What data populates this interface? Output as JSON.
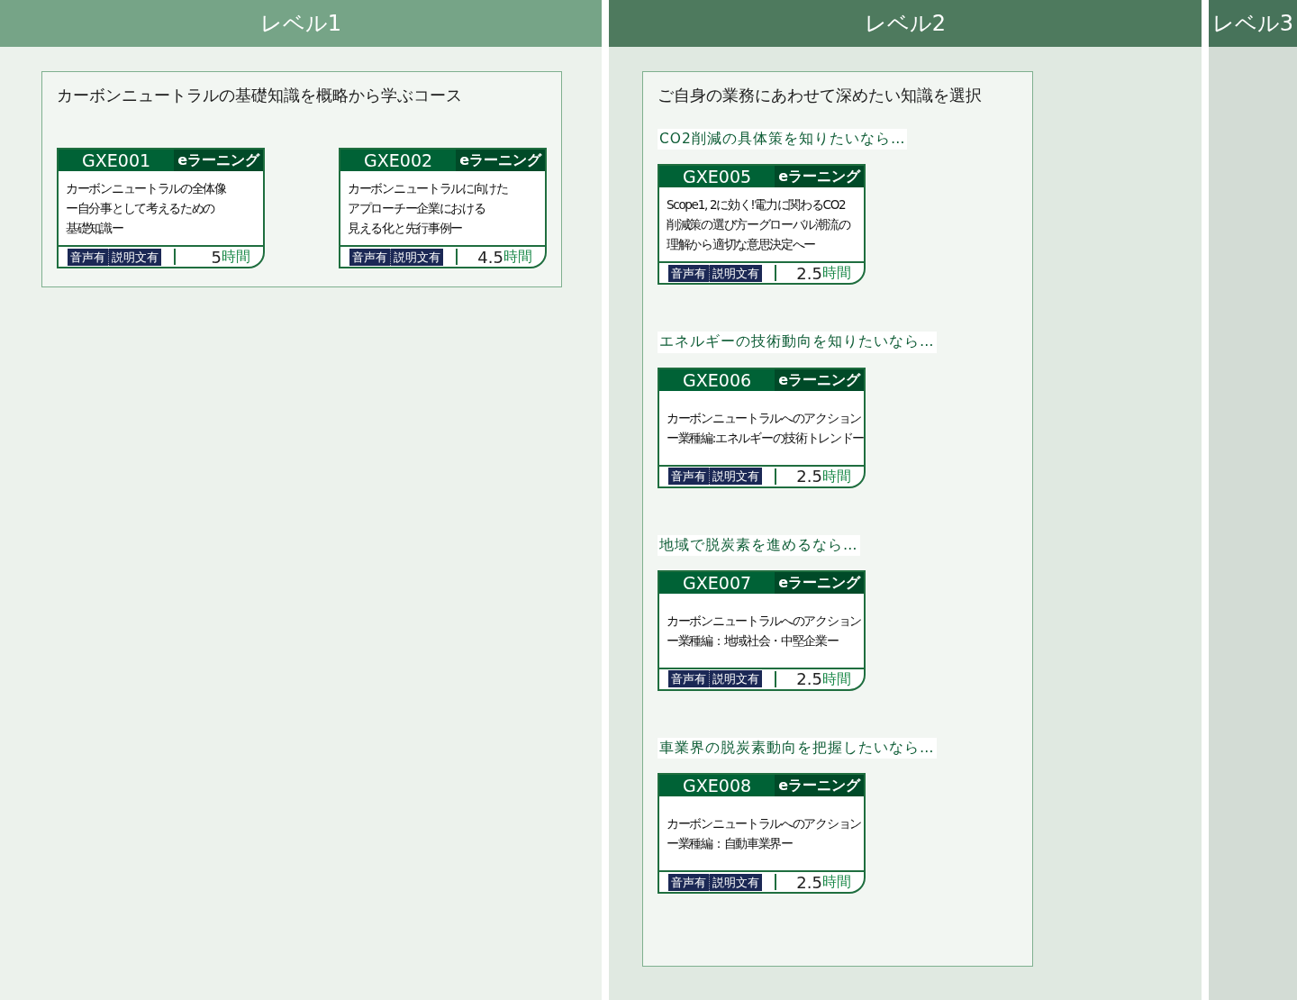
{
  "levels": [
    {
      "label": "レベル1",
      "groups": [
        {
          "title": "カーボンニュートラルの基礎知識を概略から学ぶコース",
          "courses": [
            {
              "code": "GXE001",
              "type": "eラーニング",
              "title_lines": [
                "カーボンニュートラルの全体像",
                "ー自分事として考えるための",
                "基礎知識ー"
              ],
              "tags": [
                "音声有",
                "説明文有"
              ],
              "hours": "5",
              "unit": "時間"
            },
            {
              "code": "GXE002",
              "type": "eラーニング",
              "title_lines": [
                "カーボンニュートラルに向けた",
                "アプローチー企業における",
                "見える化と先行事例ー"
              ],
              "tags": [
                "音声有",
                "説明文有"
              ],
              "hours": "4.5",
              "unit": "時間"
            }
          ]
        }
      ]
    },
    {
      "label": "レベル2",
      "groups": [
        {
          "title": "ご自身の業務にあわせて深めたい知識を選択",
          "sections": [
            {
              "prompt": "CO2削減の具体策を知りたいなら…",
              "courses": [
                {
                  "code": "GXE005",
                  "type": "eラーニング",
                  "title_lines": [
                    "Scope1, 2に効く!電力に関わるCO2",
                    "削減策の選び方ーグローバル潮流の",
                    "理解から適切な意思決定へー"
                  ],
                  "tags": [
                    "音声有",
                    "説明文有"
                  ],
                  "hours": "2.5",
                  "unit": "時間"
                }
              ]
            },
            {
              "prompt": "エネルギーの技術動向を知りたいなら…",
              "courses": [
                {
                  "code": "GXE006",
                  "type": "eラーニング",
                  "title_lines": [
                    "カーボンニュートラルへのアクション",
                    "ー業種編:エネルギーの技術トレンドー"
                  ],
                  "tags": [
                    "音声有",
                    "説明文有"
                  ],
                  "hours": "2.5",
                  "unit": "時間"
                }
              ]
            },
            {
              "prompt": "地域で脱炭素を進めるなら…",
              "courses": [
                {
                  "code": "GXE007",
                  "type": "eラーニング",
                  "title_lines": [
                    "カーボンニュートラルへのアクション",
                    "ー業種編：地域社会・中堅企業ー"
                  ],
                  "tags": [
                    "音声有",
                    "説明文有"
                  ],
                  "hours": "2.5",
                  "unit": "時間"
                }
              ]
            },
            {
              "prompt": "車業界の脱炭素動向を把握したいなら…",
              "courses": [
                {
                  "code": "GXE008",
                  "type": "eラーニング",
                  "title_lines": [
                    "カーボンニュートラルへのアクション",
                    "ー業種編：自動車業界ー"
                  ],
                  "tags": [
                    "音声有",
                    "説明文有"
                  ],
                  "hours": "2.5",
                  "unit": "時間"
                }
              ]
            }
          ]
        }
      ]
    },
    {
      "label": "レベル3"
    }
  ]
}
